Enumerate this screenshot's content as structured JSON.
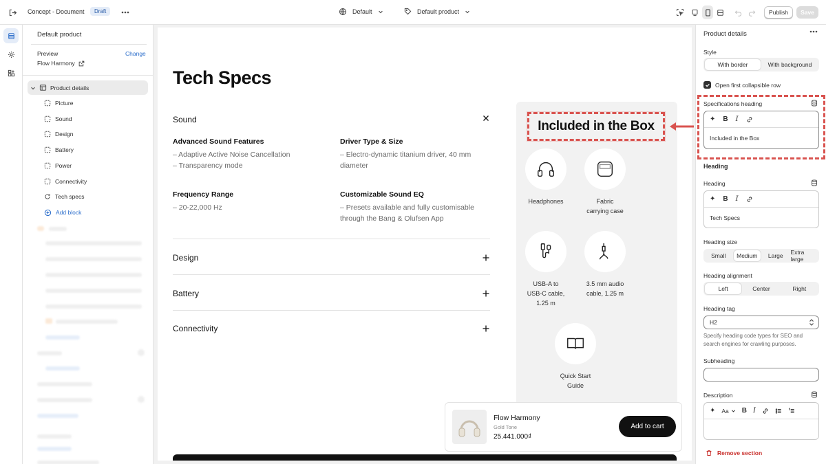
{
  "topbar": {
    "doc_title": "Concept - Document",
    "status_badge": "Draft",
    "theme_selector": "Default",
    "template_selector": "Default product",
    "publish_label": "Publish",
    "save_label": "Save"
  },
  "left_panel": {
    "title": "Default product",
    "preview_label": "Preview",
    "change_label": "Change",
    "preview_product": "Flow Harmony",
    "section": "Product details",
    "blocks": [
      "Picture",
      "Sound",
      "Design",
      "Battery",
      "Power",
      "Connectivity",
      "Tech specs"
    ],
    "add_block_label": "Add block"
  },
  "page": {
    "heading": "Tech Specs",
    "open_row": {
      "title": "Sound",
      "features": [
        {
          "title": "Advanced Sound Features",
          "lines": [
            "– Adaptive Active Noise Cancellation",
            "– Transparency mode"
          ]
        },
        {
          "title": "Driver Type & Size",
          "lines": [
            "– Electro-dynamic titanium driver, 40 mm",
            "diameter"
          ]
        },
        {
          "title": "Frequency Range",
          "lines": [
            "– 20-22,000 Hz"
          ]
        },
        {
          "title": "Customizable Sound EQ",
          "lines": [
            "– Presets available and fully customisable",
            "through the Bang & Olufsen App"
          ]
        }
      ]
    },
    "collapsed_rows": [
      "Design",
      "Battery",
      "Connectivity"
    ],
    "box": {
      "heading": "Included in the Box",
      "items": [
        {
          "lines": [
            "Headphones"
          ],
          "icon": "headphones-icon"
        },
        {
          "lines": [
            "Fabric",
            "carrying case"
          ],
          "icon": "case-icon"
        },
        {
          "lines": [
            "USB-A to",
            "USB-C cable,",
            "1.25 m"
          ],
          "icon": "usb-cable-icon"
        },
        {
          "lines": [
            "3.5 mm audio",
            "cable, 1.25 m"
          ],
          "icon": "audio-cable-icon"
        },
        {
          "lines": [
            "Quick Start",
            "Guide"
          ],
          "icon": "book-icon"
        }
      ]
    },
    "sticky_cart": {
      "product_name": "Flow Harmony",
      "variant": "Gold Tone",
      "price": "25.441.000₫",
      "button_label": "Add to cart"
    }
  },
  "right_panel": {
    "title": "Product details",
    "style_label": "Style",
    "style_options": [
      "With border",
      "With background"
    ],
    "style_selected": "With border",
    "open_first_label": "Open first collapsible row",
    "open_first_checked": true,
    "spec_heading_label": "Specifications heading",
    "spec_heading_value": "Included in the Box",
    "heading_group": "Heading",
    "heading_label": "Heading",
    "heading_value": "Tech Specs",
    "heading_size_label": "Heading size",
    "heading_size_options": [
      "Small",
      "Medium",
      "Large",
      "Extra large"
    ],
    "heading_size_selected": "Medium",
    "heading_align_label": "Heading alignment",
    "heading_align_options": [
      "Left",
      "Center",
      "Right"
    ],
    "heading_align_selected": "Left",
    "heading_tag_label": "Heading tag",
    "heading_tag_value": "H2",
    "heading_tag_help": [
      "Specify heading code types for SEO and",
      "search engines for crawling purposes."
    ],
    "subheading_label": "Subheading",
    "subheading_value": "",
    "description_label": "Description",
    "remove_label": "Remove section",
    "rte_format_label": "Aa"
  },
  "colors": {
    "accent_blue": "#2c6ecb",
    "annotation_red": "#d9534f",
    "danger": "#c9302c"
  }
}
